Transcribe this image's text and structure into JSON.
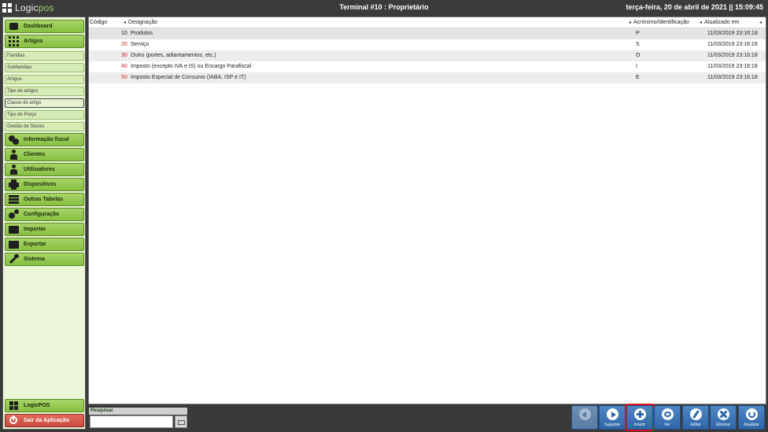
{
  "topbar": {
    "logo_prefix": "Logic",
    "logo_suffix": "pos",
    "title": "Terminal #10 : Proprietário",
    "clock": "terça-feira, 20 de abril de 2021 || 15:09:45"
  },
  "sidebar": {
    "dashboard": "Dashboard",
    "artigos": "Artigos",
    "sub_items": [
      "Famílias",
      "Subfamílias",
      "Artigos",
      "Tipo de artigos",
      "Classe do artigo",
      "Tipo de Preço",
      "Gestão de Stocks"
    ],
    "info_fiscal": "Informação fiscal",
    "clientes": "Clientes",
    "utilizadores": "Utilizadores",
    "dispositivos": "Dispositivos",
    "outras_tabelas": "Outras Tabelas",
    "configuracao": "Configuração",
    "importar": "Importar",
    "exportar": "Exportar",
    "sistema": "Sistema",
    "logicpos": "LogicPOS",
    "sair": "Sair da Aplicação"
  },
  "table": {
    "columns": [
      "Código",
      "Designação",
      "Acrónimo/Identificação",
      "Atualizado em"
    ],
    "rows": [
      {
        "code": "10",
        "name": "Produtos",
        "acronym": "P",
        "updated": "11/03/2019 23:16:18"
      },
      {
        "code": "20",
        "name": "Serviço",
        "acronym": "S",
        "updated": "11/03/2019 23:16:18"
      },
      {
        "code": "30",
        "name": "Outro (portes, adiantamentos, etc.)",
        "acronym": "O",
        "updated": "11/03/2019 23:16:18"
      },
      {
        "code": "40",
        "name": "Imposto (excepto IVA e IS) ou Encargo Parafiscal",
        "acronym": "I",
        "updated": "11/03/2019 23:16:18"
      },
      {
        "code": "50",
        "name": "Imposto Especial de Consumo (IABA, ISP e IT)",
        "acronym": "E",
        "updated": "11/03/2019 23:16:18"
      }
    ]
  },
  "search": {
    "label": "Pesquisar",
    "value": ""
  },
  "actions": {
    "previous": "",
    "next": "Seguinte",
    "insert": "Inserir",
    "view": "Ver",
    "edit": "Editar",
    "delete": "Eliminar",
    "refresh": "Atualizar"
  }
}
